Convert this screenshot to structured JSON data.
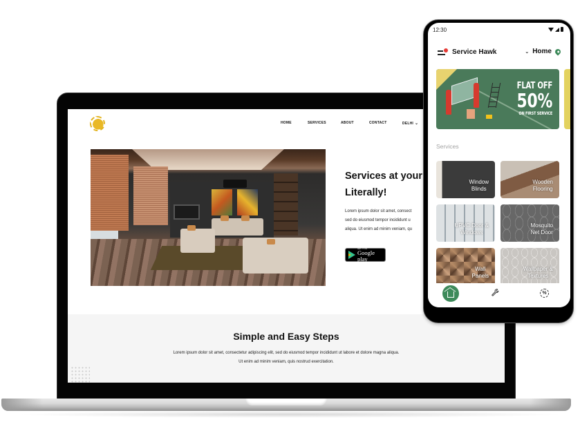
{
  "website": {
    "nav": {
      "items": [
        {
          "label": "HOME"
        },
        {
          "label": "SERVICES"
        },
        {
          "label": "ABOUT"
        },
        {
          "label": "CONTACT"
        },
        {
          "label": "DELHI"
        }
      ],
      "city_chevron": "⌄"
    },
    "hero": {
      "title_line1": "Services at your",
      "title_line2": "Literally!",
      "text_line1": "Lorem ipsum dolor sit amet, consect",
      "text_line2": "sed do eiusmod tempor incididunt u",
      "text_line3": "aliqua. Ut enim ad minim veniam, qu",
      "store_badge_small": "GET IT ON",
      "store_badge_label": "Google play"
    },
    "steps": {
      "title": "Simple and Easy Steps",
      "text_line1": "Lorem ipsum dolor sit amet, consectetur adipiscing elit, sed do eiusmod tempor incididunt ut labore et dolore magna aliqua.",
      "text_line2": "Ut enim ad minim veniam, quis nostrud exercitation."
    }
  },
  "phone": {
    "status": {
      "time": "12:30"
    },
    "app_bar": {
      "title": "Service Hawk",
      "location_chevron": "⌄",
      "location": "Home"
    },
    "banner": {
      "line1": "FLAT OFF",
      "line2": "50%",
      "line3": "ON FIRST SERVICE"
    },
    "services_label": "Services",
    "services": [
      {
        "line1": "Window",
        "line2": "Blinds"
      },
      {
        "line1": "Wooden",
        "line2": "Flooring"
      },
      {
        "line1": "UPVC Door &",
        "line2": "Windows"
      },
      {
        "line1": "Mosquito",
        "line2": "Net Door"
      },
      {
        "line1": "Wall",
        "line2": "Panels"
      },
      {
        "line1": "Wallpaper &",
        "line2": "Textures"
      }
    ],
    "bottom_nav": {
      "wrench_glyph": "🔧",
      "offer_glyph": "%"
    }
  },
  "colors": {
    "brand_green": "#3d8a5a",
    "banner_green": "#4a7a5a",
    "logo_gold": "#e2b31d",
    "notification_red": "#e53935"
  }
}
